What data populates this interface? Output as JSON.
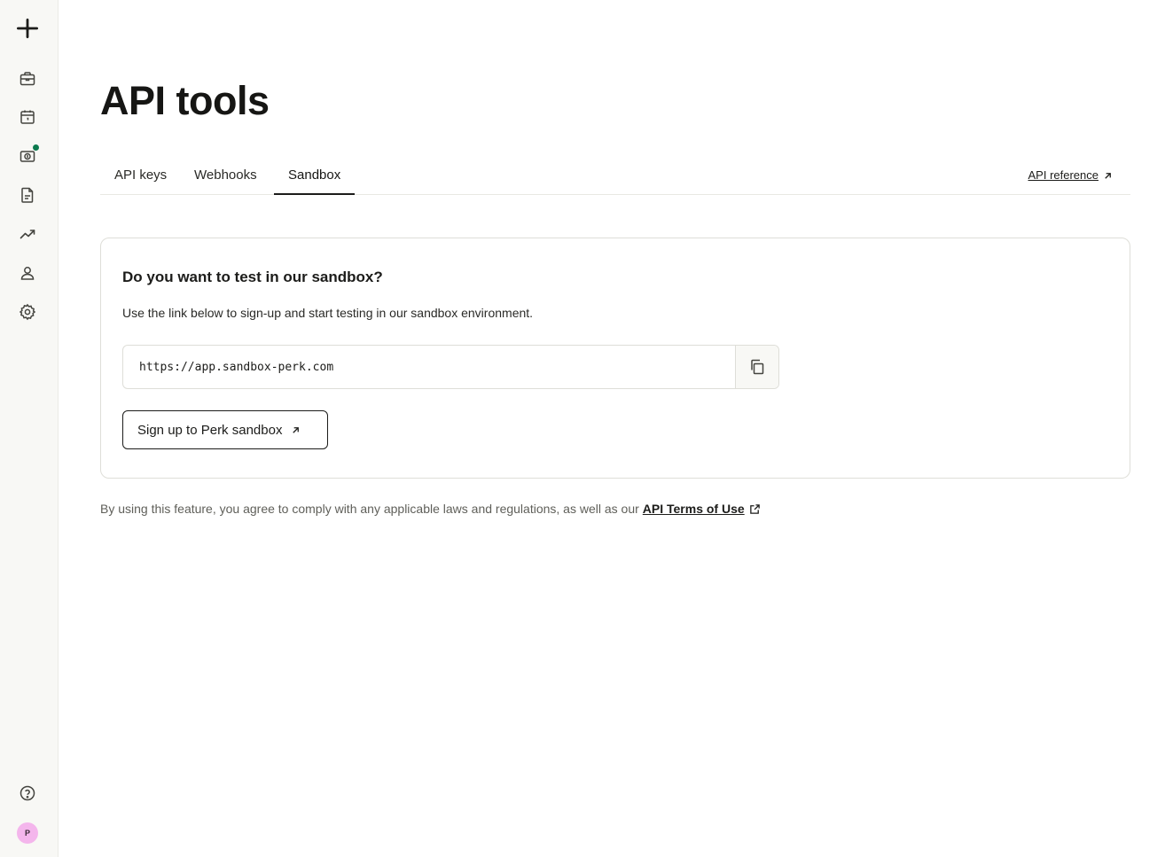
{
  "colors": {
    "sidebar_bg": "#f8f8f5",
    "notification_dot": "#0c7a4e",
    "avatar_bg": "#f4b6ec",
    "text": "#1c1c1a",
    "muted_text": "#5f5f59",
    "border": "#deded8"
  },
  "sidebar": {
    "logo_icon": "plus-star-icon",
    "items": [
      {
        "name": "briefcase",
        "icon": "briefcase-icon"
      },
      {
        "name": "calendar",
        "icon": "calendar-icon"
      },
      {
        "name": "billing",
        "icon": "money-icon",
        "has_notification": true
      },
      {
        "name": "documents",
        "icon": "document-icon"
      },
      {
        "name": "analytics",
        "icon": "trend-up-icon"
      },
      {
        "name": "people",
        "icon": "user-icon"
      },
      {
        "name": "settings",
        "icon": "gear-icon"
      }
    ],
    "help_icon": "help-circle-icon",
    "avatar_initial": "P"
  },
  "page": {
    "title": "API tools"
  },
  "tabs": [
    {
      "label": "API keys",
      "active": false
    },
    {
      "label": "Webhooks",
      "active": false
    },
    {
      "label": "Sandbox",
      "active": true
    }
  ],
  "api_reference": {
    "label": "API reference",
    "icon": "arrow-up-right-icon"
  },
  "sandbox_card": {
    "title": "Do you want to test in our sandbox?",
    "description": "Use the link below to sign-up and start testing in our sandbox environment.",
    "url_value": "https://app.sandbox-perk.com",
    "copy_icon": "copy-icon",
    "signup_label": "Sign up to Perk sandbox",
    "signup_icon": "arrow-up-right-icon"
  },
  "footer": {
    "text": "By using this feature, you agree to comply with any applicable laws and regulations, as well as our",
    "link_label": "API Terms of Use",
    "link_icon": "external-link-icon"
  }
}
